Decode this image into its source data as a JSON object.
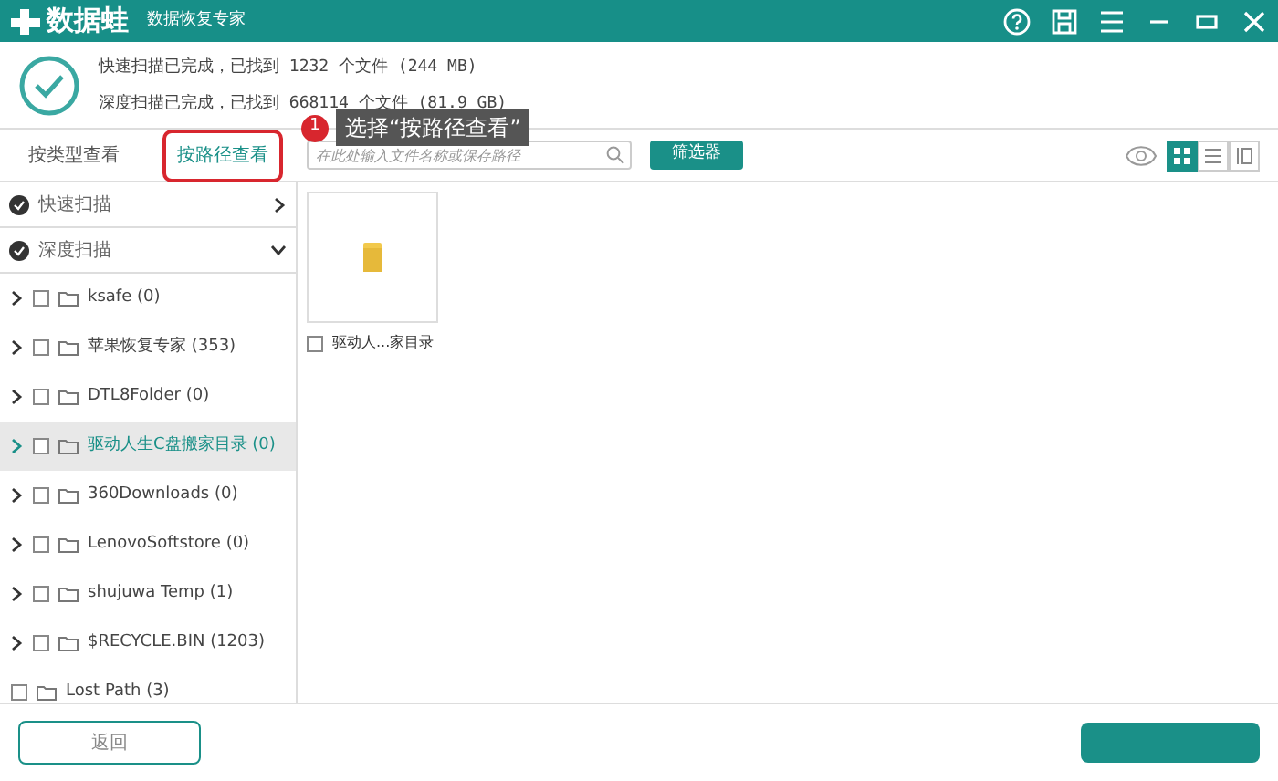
{
  "window": {
    "app_name": "数据蛙",
    "subtitle": "数据恢复专家"
  },
  "summary": {
    "lines": [
      "快速扫描已完成，已找到 1232 个文件 (244 MB)",
      "深度扫描已完成，已找到 668114 个文件 (81.9 GB)"
    ]
  },
  "tabs": [
    {
      "label": "按类型查看",
      "selected": false
    },
    {
      "label": "按路径查看",
      "selected": true
    }
  ],
  "annotation": {
    "number": "1",
    "text": "选择“按路径查看”"
  },
  "search": {
    "placeholder": "在此处输入文件名称或保存路径"
  },
  "filter_button": "筛选器",
  "view_modes": [
    {
      "kind": "grid",
      "selected": true
    },
    {
      "kind": "list",
      "selected": false
    },
    {
      "kind": "detail",
      "selected": false
    }
  ],
  "scans": [
    {
      "label": "快速扫描",
      "expanded": false
    },
    {
      "label": "深度扫描",
      "expanded": true
    }
  ],
  "tree": [
    {
      "label": "ksafe (0)",
      "expandable": true,
      "checked": false,
      "selected": false
    },
    {
      "label": "苹果恢复专家 (353)",
      "expandable": true,
      "checked": false,
      "selected": false
    },
    {
      "label": "DTL8Folder (0)",
      "expandable": true,
      "checked": false,
      "selected": false
    },
    {
      "label": "驱动人生C盘搬家目录 (0)",
      "expandable": true,
      "checked": false,
      "selected": true
    },
    {
      "label": "360Downloads (0)",
      "expandable": true,
      "checked": false,
      "selected": false
    },
    {
      "label": "LenovoSoftstore (0)",
      "expandable": true,
      "checked": false,
      "selected": false
    },
    {
      "label": "shujuwa Temp (1)",
      "expandable": true,
      "checked": false,
      "selected": false
    },
    {
      "label": "$RECYCLE.BIN (1203)",
      "expandable": true,
      "checked": false,
      "selected": false
    },
    {
      "label": "Lost Path (3)",
      "expandable": false,
      "checked": false,
      "selected": false
    }
  ],
  "files": [
    {
      "name": "驱动人...家目录",
      "checked": false
    }
  ],
  "back_button": "返回"
}
